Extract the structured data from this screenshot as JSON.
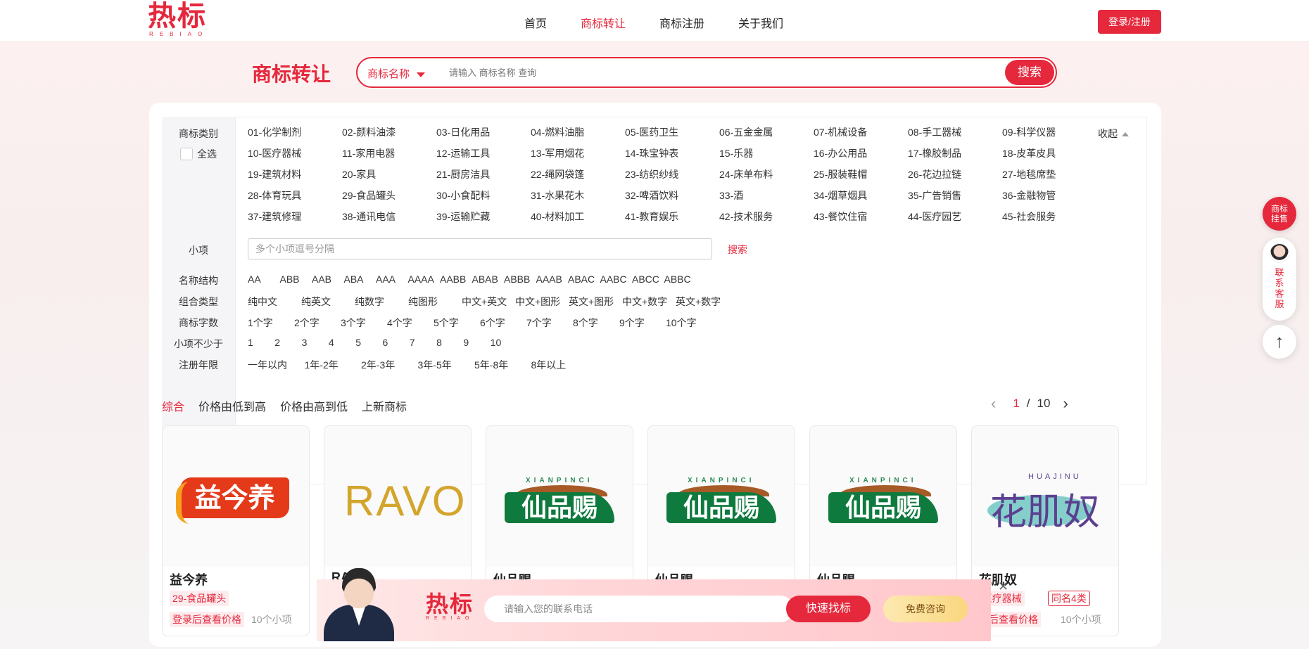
{
  "header": {
    "logo": "热标",
    "logo_sub": "REBIAO",
    "nav": [
      "首页",
      "商标转让",
      "商标注册",
      "关于我们"
    ],
    "login": "登录/注册"
  },
  "search": {
    "title": "商标转让",
    "type": "商标名称",
    "placeholder": "请输入 商标名称 查询",
    "button": "搜索"
  },
  "filters": {
    "category_label": "商标类别",
    "select_all": "全选",
    "collapse": "收起",
    "classes": [
      "01-化学制剂",
      "02-颜料油漆",
      "03-日化用品",
      "04-燃料油脂",
      "05-医药卫生",
      "06-五金金属",
      "07-机械设备",
      "08-手工器械",
      "09-科学仪器",
      "10-医疗器械",
      "11-家用电器",
      "12-运输工具",
      "13-军用烟花",
      "14-珠宝钟表",
      "15-乐器",
      "16-办公用品",
      "17-橡胶制品",
      "18-皮革皮具",
      "19-建筑材料",
      "20-家具",
      "21-厨房洁具",
      "22-绳网袋篷",
      "23-纺织纱线",
      "24-床单布料",
      "25-服装鞋帽",
      "26-花边拉链",
      "27-地毯席垫",
      "28-体育玩具",
      "29-食品罐头",
      "30-小食配料",
      "31-水果花木",
      "32-啤酒饮料",
      "33-酒",
      "34-烟草烟具",
      "35-广告销售",
      "36-金融物管",
      "37-建筑修理",
      "38-通讯电信",
      "39-运输贮藏",
      "40-材料加工",
      "41-教育娱乐",
      "42-技术服务",
      "43-餐饮住宿",
      "44-医疗园艺",
      "45-社会服务"
    ],
    "subitem_label": "小项",
    "subitem_placeholder": "多个小项逗号分隔",
    "subitem_search": "搜索",
    "structure_label": "名称结构",
    "structures": [
      "AA",
      "ABB",
      "AAB",
      "ABA",
      "AAA",
      "AAAA",
      "AABB",
      "ABAB",
      "ABBB",
      "AAAB",
      "ABAC",
      "AABC",
      "ABCC",
      "ABBC"
    ],
    "combo_label": "组合类型",
    "combos": [
      "纯中文",
      "纯英文",
      "纯数字",
      "纯图形",
      "中文+英文",
      "中文+图形",
      "英文+图形",
      "中文+数字",
      "英文+数字"
    ],
    "count_label": "商标字数",
    "counts": [
      "1个字",
      "2个字",
      "3个字",
      "4个字",
      "5个字",
      "6个字",
      "7个字",
      "8个字",
      "9个字",
      "10个字"
    ],
    "min_items_label": "小项不少于",
    "min_items": [
      "1",
      "2",
      "3",
      "4",
      "5",
      "6",
      "7",
      "8",
      "9",
      "10"
    ],
    "years_label": "注册年限",
    "years": [
      "一年以内",
      "1年-2年",
      "2年-3年",
      "3年-5年",
      "5年-8年",
      "8年以上"
    ]
  },
  "sort": {
    "options": [
      "综合",
      "价格由低到高",
      "价格由高到低",
      "上新商标"
    ],
    "page_current": "1",
    "page_sep": "/",
    "page_total": "10"
  },
  "cards": [
    {
      "name": "益今养",
      "logo_text": "益今养",
      "class": "29-食品罐头",
      "price": "登录后查看价格",
      "items": "10个小项"
    },
    {
      "name": "RA",
      "logo_text": "RAVO"
    },
    {
      "name": "仙品赐",
      "logo_text": "仙品赐",
      "logo_pinyin": "XIANPINCI"
    },
    {
      "name": "仙品赐",
      "logo_text": "仙品赐",
      "logo_pinyin": "XIANPINCI"
    },
    {
      "name": "仙品赐",
      "logo_text": "仙品赐",
      "logo_pinyin": "XIANPINCI"
    },
    {
      "name": "花肌奴",
      "logo_text": "花肌奴",
      "logo_pinyin": "HUAJINU",
      "class": "-医疗器械",
      "tag": "同名4类",
      "price": "录后查看价格",
      "items": "10个小项"
    }
  ],
  "float": {
    "sale": "商标挂售",
    "service": "联系客服",
    "top_icon": "arrow-up-icon"
  },
  "banner": {
    "logo": "热标",
    "logo_sub": "REBIAO",
    "placeholder": "请输入您的联系电话",
    "find": "快速找标",
    "consult": "免费咨询",
    "close_icon": "close-icon"
  },
  "colors": {
    "accent": "#e5283c",
    "gold": "#f9d77f"
  }
}
